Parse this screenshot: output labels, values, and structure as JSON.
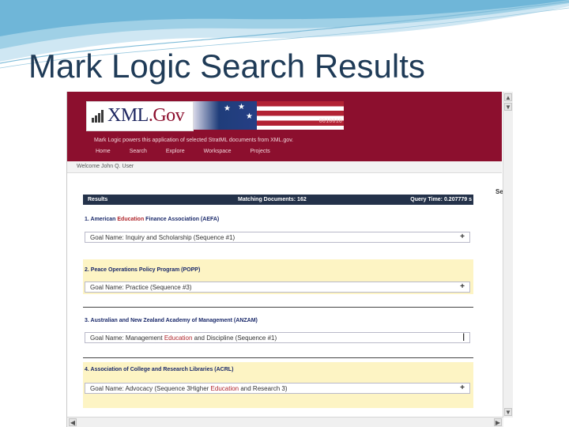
{
  "slide": {
    "title": "Mark Logic Search Results"
  },
  "site": {
    "logo": {
      "prefix": "XML",
      "suffix": ".Gov"
    },
    "flag_binary": "0010010",
    "tagline": "Mark Logic powers this application of selected StratML documents from XML.gov.",
    "nav": [
      "Home",
      "Search",
      "Explore",
      "Workspace",
      "Projects"
    ],
    "welcome": "Welcome John Q. User"
  },
  "results_bar": {
    "label": "Results",
    "matching": "Matching Documents: 162",
    "query_time": "Query Time: 0.207779 s"
  },
  "side_letter": "Se",
  "results": [
    {
      "num": "1.",
      "title_pre": "American ",
      "title_em": "Education",
      "title_post": " Finance Association (AEFA)",
      "goal_pre": "Goal Name: Inquiry and Scholarship (Sequence #1)",
      "goal_em": "",
      "goal_post": "",
      "goal_icon": "+"
    },
    {
      "num": "2.",
      "title_pre": "Peace Operations Policy Program (POPP)",
      "title_em": "",
      "title_post": "",
      "goal_pre": "Goal Name: Practice (Sequence #3)",
      "goal_em": "",
      "goal_post": "",
      "goal_icon": "+"
    },
    {
      "num": "3.",
      "title_pre": "Australian and New Zealand Academy of Management (ANZAM)",
      "title_em": "",
      "title_post": "",
      "goal_pre": "Goal Name: Management ",
      "goal_em": "Education",
      "goal_post": " and Discipline (Sequence #1)",
      "goal_icon": "|"
    },
    {
      "num": "4.",
      "title_pre": "Association of College and Research Libraries (ACRL)",
      "title_em": "",
      "title_post": "",
      "goal_pre": "Goal Name: Advocacy (Sequence 3Higher ",
      "goal_em": "Education",
      "goal_post": " and Research 3)",
      "goal_icon": "+"
    }
  ],
  "colors": {
    "header": "#8c0f2e",
    "results_bar": "#24324a",
    "highlight": "#fdf4c4",
    "title": "#1f3b57"
  },
  "icons": {
    "scroll_up": "▲",
    "scroll_down": "▼",
    "scroll_left": "◀",
    "scroll_right": "▶"
  }
}
